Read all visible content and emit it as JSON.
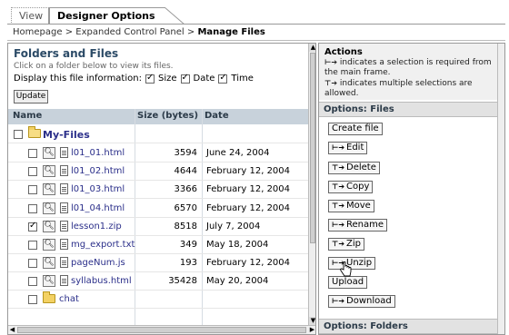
{
  "tabs": {
    "view": "View",
    "designer": "Designer Options"
  },
  "breadcrumb": {
    "home": "Homepage",
    "sep": ">",
    "panel": "Expanded Control Panel",
    "current": "Manage Files"
  },
  "left": {
    "title": "Folders and Files",
    "subtitle": "Click on a folder below to view its files.",
    "display_label": "Display this file information:",
    "opt_size": "Size",
    "opt_date": "Date",
    "opt_time": "Time",
    "update_label": "Update",
    "col_name": "Name",
    "col_size": "Size (bytes)",
    "col_date": "Date",
    "root_folder": "My-Files",
    "files": [
      {
        "name": "l01_01.html",
        "size": "3594",
        "date": "June 24, 2004",
        "checked": false
      },
      {
        "name": "l01_02.html",
        "size": "4644",
        "date": "February 12, 2004",
        "checked": false
      },
      {
        "name": "l01_03.html",
        "size": "3366",
        "date": "February 12, 2004",
        "checked": false
      },
      {
        "name": "l01_04.html",
        "size": "6570",
        "date": "February 12, 2004",
        "checked": false
      },
      {
        "name": "lesson1.zip",
        "size": "8518",
        "date": "July 7, 2004",
        "checked": true
      },
      {
        "name": "mg_export.txt",
        "size": "349",
        "date": "May 18, 2004",
        "checked": false
      },
      {
        "name": "pageNum.js",
        "size": "193",
        "date": "February 12, 2004",
        "checked": false
      },
      {
        "name": "syllabus.html",
        "size": "35428",
        "date": "May 20, 2004",
        "checked": false
      }
    ],
    "subfolder": "chat"
  },
  "right": {
    "actions_title": "Actions",
    "actions_line1": "indicates a selection is required from the main frame.",
    "actions_line2": "indicates multiple selections are allowed.",
    "files_section": "Options: Files",
    "folders_section": "Options: Folders",
    "buttons": {
      "create": "Create file",
      "edit": "Edit",
      "delete": "Delete",
      "copy": "Copy",
      "move": "Move",
      "rename": "Rename",
      "zip": "Zip",
      "unzip": "Unzip",
      "upload": "Upload",
      "download": "Download"
    }
  },
  "colors": {
    "link": "#2b2f8a",
    "header_bg": "#c8d2db",
    "title": "#2b4a66"
  },
  "icons": [
    "magnifier-icon",
    "file-icon",
    "folder-icon",
    "single-select-arrow-icon",
    "multi-select-arrow-icon",
    "hand-cursor-icon"
  ]
}
